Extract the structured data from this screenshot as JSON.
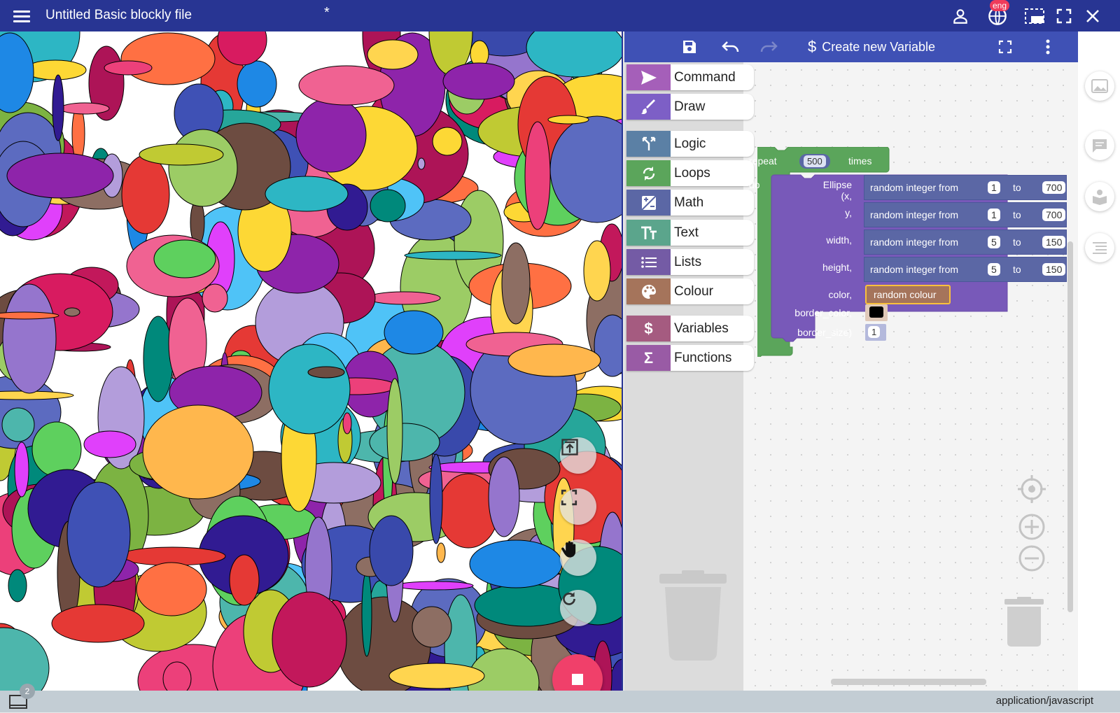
{
  "app": {
    "title": "Untitled Basic blockly file",
    "modified_marker": "*",
    "language_badge": "eng"
  },
  "topbar_icons": [
    "menu-icon",
    "user-icon",
    "globe-icon",
    "screenshot-icon",
    "fullscreen-icon",
    "close-icon"
  ],
  "editor_toolbar": {
    "create_variable_symbol": "$",
    "create_variable_label": "Create new Variable"
  },
  "categories": [
    {
      "label": "Command",
      "color": "#a55fb9",
      "icon": "paper-plane-icon"
    },
    {
      "label": "Draw",
      "color": "#7d5fc6",
      "icon": "brush-icon"
    },
    {
      "label": "Logic",
      "color": "#5b80a5",
      "icon": "fork-icon"
    },
    {
      "label": "Loops",
      "color": "#5ba55b",
      "icon": "loop-icon"
    },
    {
      "label": "Math",
      "color": "#5b67a5",
      "icon": "math-icon"
    },
    {
      "label": "Text",
      "color": "#5ba58c",
      "icon": "text-icon"
    },
    {
      "label": "Lists",
      "color": "#745ba5",
      "icon": "list-icon"
    },
    {
      "label": "Colour",
      "color": "#a5745b",
      "icon": "palette-icon"
    },
    {
      "label": "Variables",
      "color": "#a55b80",
      "icon": "dollar-icon",
      "symbol": "$"
    },
    {
      "label": "Functions",
      "color": "#995ba5",
      "icon": "sigma-icon",
      "symbol": "Σ"
    }
  ],
  "blocks": {
    "repeat": {
      "label": "repeat",
      "count": "500",
      "times": "times",
      "do": "do"
    },
    "ellipse": {
      "label_x": "Ellipse (x,",
      "label_y": "y,",
      "label_width": "width,",
      "label_height": "height,",
      "label_color": "color,",
      "label_border_color": "border_color,",
      "label_border_size": "border_size)",
      "border_size_value": "1"
    },
    "random_rows": [
      {
        "text": "random integer from",
        "from": "1",
        "to_label": "to",
        "to": "700"
      },
      {
        "text": "random integer from",
        "from": "1",
        "to_label": "to",
        "to": "700"
      },
      {
        "text": "random integer from",
        "from": "5",
        "to_label": "to",
        "to": "150"
      },
      {
        "text": "random integer from",
        "from": "5",
        "to_label": "to",
        "to": "150"
      }
    ],
    "random_colour": "random colour",
    "border_color_swatch": "#000000"
  },
  "status": {
    "mime": "application/javascript",
    "console_count": "2"
  },
  "colors": {
    "topbar": "#283593",
    "toolbar": "#3f51b5",
    "stop_button": "#f0406a"
  }
}
